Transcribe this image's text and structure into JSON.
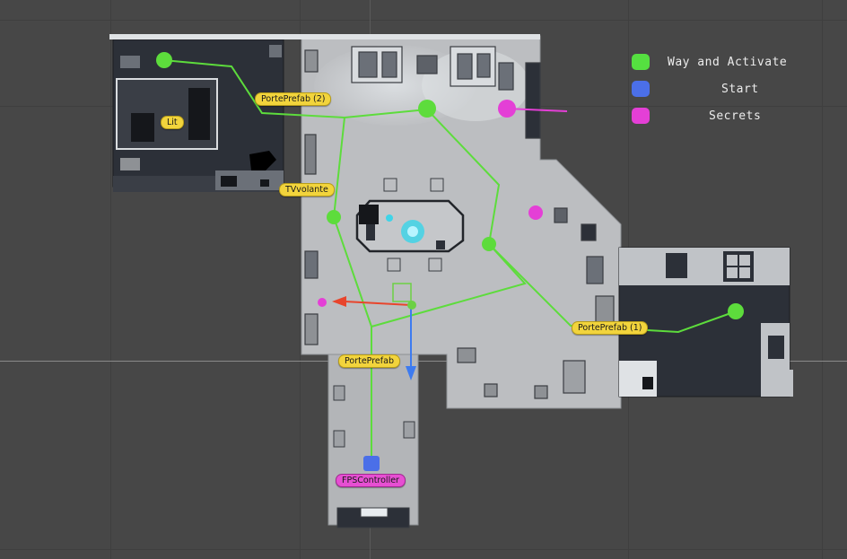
{
  "legend": {
    "items": [
      {
        "label": "Way and Activate",
        "color": "#55e040"
      },
      {
        "label": "Start",
        "color": "#4b6fe8"
      },
      {
        "label": "Secrets",
        "color": "#e43fd6"
      }
    ]
  },
  "scene_objects": {
    "porte_prefab_2": "PortePrefab (2)",
    "lit": "Lit",
    "tv_volante": "TVvolante",
    "porte_prefab_1": "PortePrefab (1)",
    "porte_prefab": "PortePrefab",
    "fps_controller": "FPSController"
  },
  "colors": {
    "background": "#474747",
    "floor": "#bfc1c4",
    "dark_room": "#2c3038",
    "path": "#5ddc3c",
    "start": "#4b6fe8",
    "secret": "#e43fd6",
    "gizmo_x": "#e8452c",
    "gizmo_y": "#6cd044",
    "gizmo_z": "#3d7bf0"
  }
}
